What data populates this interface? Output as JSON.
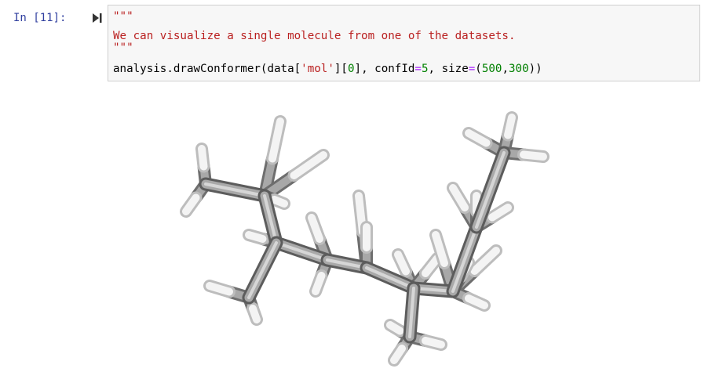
{
  "cell": {
    "prompt": "In [11]:",
    "code": {
      "line1": "\"\"\"",
      "line2": "We can visualize a single molecule from one of the datasets.",
      "line3": "\"\"\"",
      "line4": {
        "p1": "analysis.drawConformer(data[",
        "s1": "'mol'",
        "p2": "][",
        "n0": "0",
        "p3": "], confId",
        "eq1": "=",
        "n5": "5",
        "p4": ", size",
        "eq2": "=",
        "p5": "(",
        "n500": "500",
        "comma": ",",
        "n300": "300",
        "p6": "))"
      }
    }
  },
  "icons": {
    "run": "run-cell-icon"
  },
  "colors": {
    "prompt": "#303f9f",
    "string": "#ba2121",
    "number": "#008000",
    "operator": "#aa22ff",
    "cell_bg": "#f7f7f7",
    "cell_border": "#cfcfcf"
  }
}
